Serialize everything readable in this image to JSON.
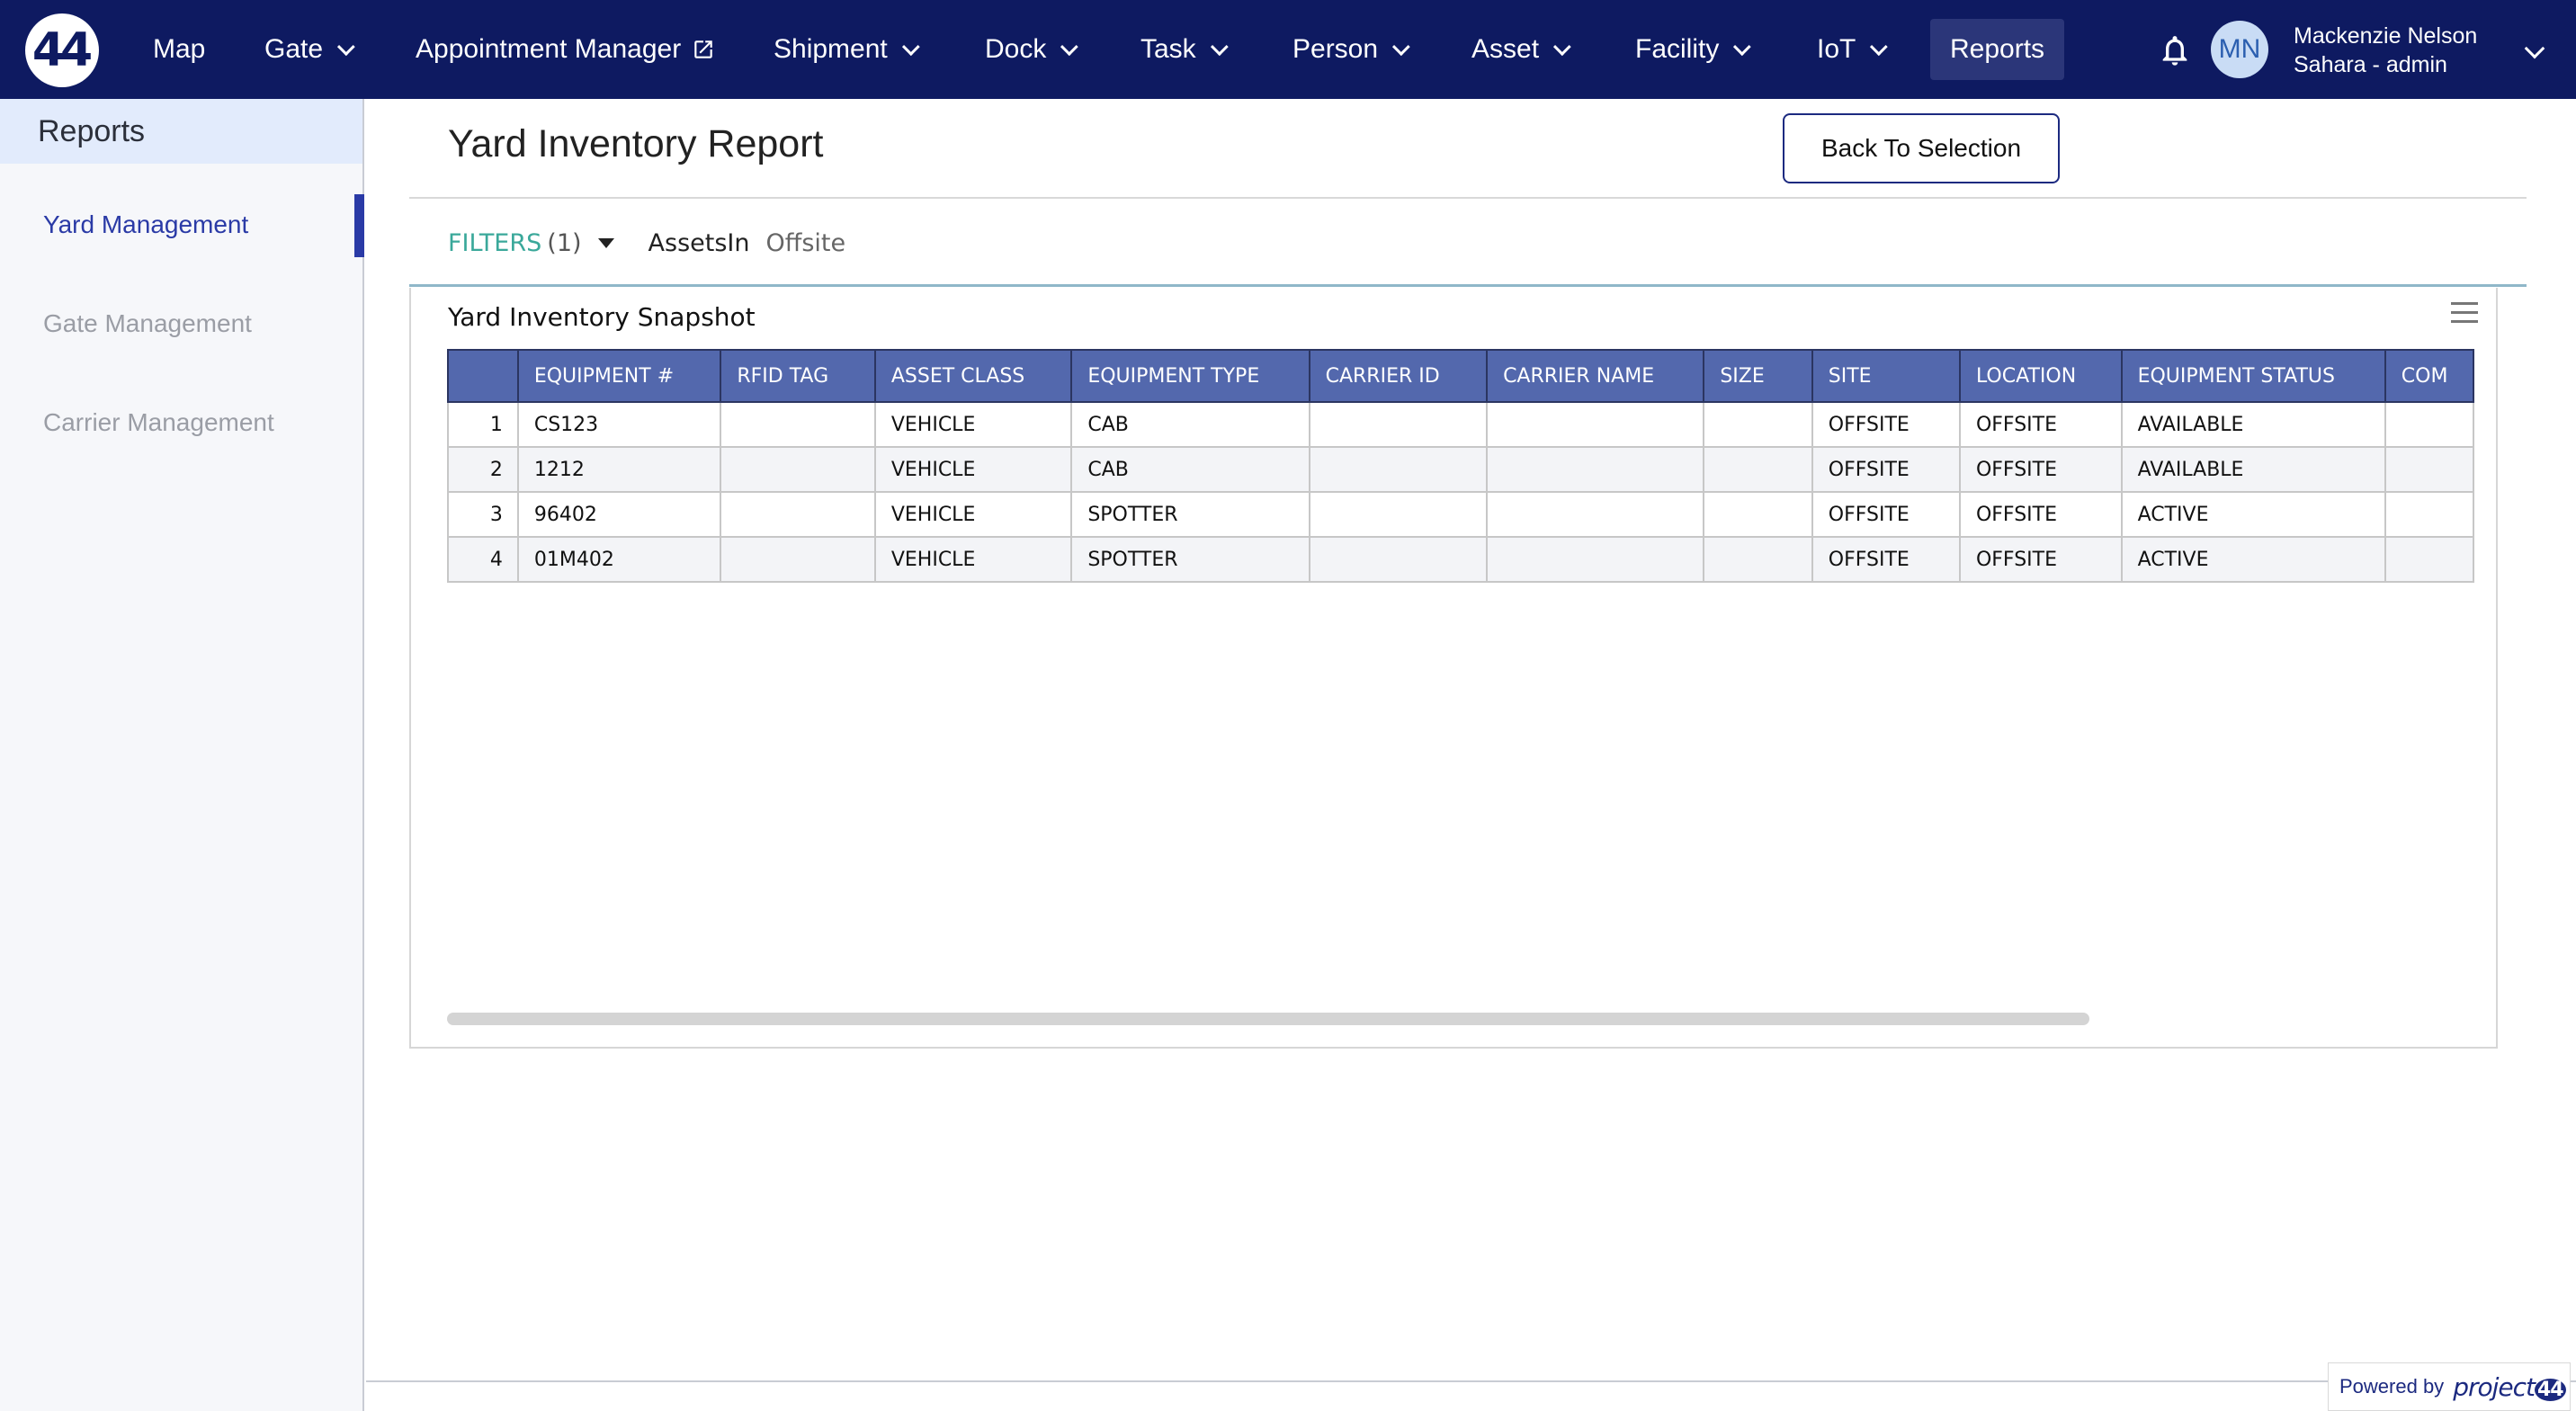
{
  "app": {
    "logo_text": "44"
  },
  "nav": {
    "items": [
      {
        "label": "Map"
      },
      {
        "label": "Gate"
      },
      {
        "label": "Appointment Manager"
      },
      {
        "label": "Shipment"
      },
      {
        "label": "Dock"
      },
      {
        "label": "Task"
      },
      {
        "label": "Person"
      },
      {
        "label": "Asset"
      },
      {
        "label": "Facility"
      },
      {
        "label": "IoT"
      },
      {
        "label": "Reports"
      }
    ]
  },
  "user": {
    "initials": "MN",
    "name": "Mackenzie Nelson",
    "role": "Sahara - admin"
  },
  "sidebar": {
    "title": "Reports",
    "items": [
      {
        "label": "Yard Management"
      },
      {
        "label": "Gate Management"
      },
      {
        "label": "Carrier Management"
      }
    ]
  },
  "main": {
    "title": "Yard Inventory Report",
    "back_label": "Back To Selection",
    "filters": {
      "label": "FILTERS",
      "count": "(1)",
      "name": "AssetsIn",
      "value": "Offsite"
    },
    "snapshot_title": "Yard Inventory Snapshot"
  },
  "table": {
    "headers": [
      "",
      "EQUIPMENT #",
      "RFID TAG",
      "ASSET CLASS",
      "EQUIPMENT TYPE",
      "CARRIER ID",
      "CARRIER NAME",
      "SIZE",
      "SITE",
      "LOCATION",
      "EQUIPMENT STATUS",
      "COM"
    ],
    "rows": [
      [
        "1",
        "CS123",
        "",
        "VEHICLE",
        "CAB",
        "",
        "",
        "",
        "OFFSITE",
        "OFFSITE",
        "AVAILABLE",
        ""
      ],
      [
        "2",
        "1212",
        "",
        "VEHICLE",
        "CAB",
        "",
        "",
        "",
        "OFFSITE",
        "OFFSITE",
        "AVAILABLE",
        ""
      ],
      [
        "3",
        "96402",
        "",
        "VEHICLE",
        "SPOTTER",
        "",
        "",
        "",
        "OFFSITE",
        "OFFSITE",
        "ACTIVE",
        ""
      ],
      [
        "4",
        "01M402",
        "",
        "VEHICLE",
        "SPOTTER",
        "",
        "",
        "",
        "OFFSITE",
        "OFFSITE",
        "ACTIVE",
        ""
      ]
    ]
  },
  "footer": {
    "powered_label": "Powered by",
    "brand": "project",
    "brand_num": "44"
  },
  "colors": {
    "nav_bg": "#0e1a61",
    "header_bg": "#5368ad",
    "accent": "#2a3aa6",
    "filter_accent": "#3aa89a"
  }
}
